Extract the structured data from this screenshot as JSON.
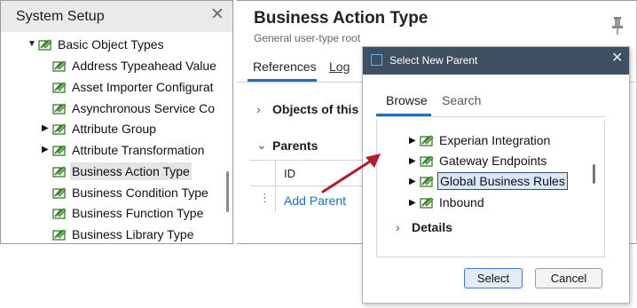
{
  "left_panel": {
    "title": "System Setup",
    "close_icon": "close-icon",
    "tree": [
      {
        "label": "Basic Object Types",
        "expander": "▼",
        "icon": "object-type-icon"
      },
      {
        "label": "Address Typeahead Value",
        "expander": "",
        "icon": "object-type-icon"
      },
      {
        "label": "Asset Importer Configurat",
        "expander": "",
        "icon": "object-type-icon"
      },
      {
        "label": "Asynchronous Service Co",
        "expander": "",
        "icon": "object-type-icon"
      },
      {
        "label": "Attribute Group",
        "expander": "▶",
        "icon": "object-type-icon"
      },
      {
        "label": "Attribute Transformation",
        "expander": "▶",
        "icon": "object-type-icon"
      },
      {
        "label": "Business Action Type",
        "expander": "",
        "icon": "object-type-icon",
        "selected": true
      },
      {
        "label": "Business Condition Type",
        "expander": "",
        "icon": "object-type-icon"
      },
      {
        "label": "Business Function Type",
        "expander": "",
        "icon": "object-type-icon"
      },
      {
        "label": "Business Library Type",
        "expander": "",
        "icon": "object-type-icon"
      }
    ]
  },
  "main": {
    "title": "Business Action Type",
    "subtitle": "General user-type root",
    "pin_icon": "pin-icon",
    "tabs": [
      {
        "label": "References",
        "active": true
      },
      {
        "label": "Log",
        "active": false
      }
    ],
    "sections": {
      "objects": "Objects of this",
      "parents": "Parents"
    },
    "table": {
      "column_id": "ID",
      "row_handle": "⋮",
      "add_parent": "Add Parent"
    }
  },
  "dialog": {
    "title": "Select New Parent",
    "close_icon": "close-icon",
    "tabs": [
      {
        "label": "Browse",
        "active": true
      },
      {
        "label": "Search",
        "active": false
      }
    ],
    "tree": [
      {
        "label": "Experian Integration",
        "expander": "▶",
        "icon": "folder-icon"
      },
      {
        "label": "Gateway Endpoints",
        "expander": "▶",
        "icon": "folder-icon"
      },
      {
        "label": "Global Business Rules",
        "expander": "▶",
        "icon": "folder-icon",
        "selected": true
      },
      {
        "label": "Inbound",
        "expander": "▶",
        "icon": "folder-icon"
      }
    ],
    "details_label": "Details",
    "buttons": {
      "select": "Select",
      "cancel": "Cancel"
    }
  },
  "annotation": {
    "arrow_color": "#b01e2c"
  },
  "colors": {
    "accent": "#1e6fbd",
    "dialog_titlebar": "#3f5062",
    "link": "#1a6fc0",
    "icon_green": "#3d8a2f"
  }
}
